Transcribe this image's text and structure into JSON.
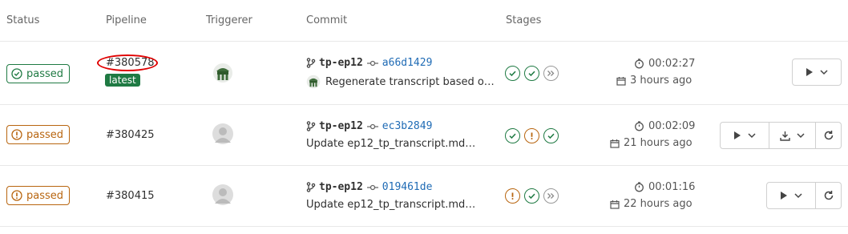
{
  "headers": {
    "status": "Status",
    "pipeline": "Pipeline",
    "triggerer": "Triggerer",
    "commit": "Commit",
    "stages": "Stages"
  },
  "rows": [
    {
      "status": "passed",
      "status_kind": "success",
      "pipeline_id": "#380578",
      "latest_label": "latest",
      "branch": "tp-ep12",
      "sha": "a66d1429",
      "message": "Regenerate transcript based o…",
      "stages": [
        "success",
        "success",
        "skipped"
      ],
      "duration": "00:02:27",
      "finished": "3 hours ago"
    },
    {
      "status": "passed",
      "status_kind": "warning",
      "pipeline_id": "#380425",
      "branch": "tp-ep12",
      "sha": "ec3b2849",
      "message": "Update ep12_tp_transcript.md…",
      "stages": [
        "success",
        "warning",
        "success"
      ],
      "duration": "00:02:09",
      "finished": "21 hours ago"
    },
    {
      "status": "passed",
      "status_kind": "warning",
      "pipeline_id": "#380415",
      "branch": "tp-ep12",
      "sha": "019461de",
      "message": "Update ep12_tp_transcript.md…",
      "stages": [
        "warning",
        "success",
        "skipped"
      ],
      "duration": "00:01:16",
      "finished": "22 hours ago"
    }
  ],
  "colors": {
    "success": "#1f7a43",
    "warning": "#b8650f",
    "link": "#1f6bb5",
    "highlight": "#e00000"
  }
}
